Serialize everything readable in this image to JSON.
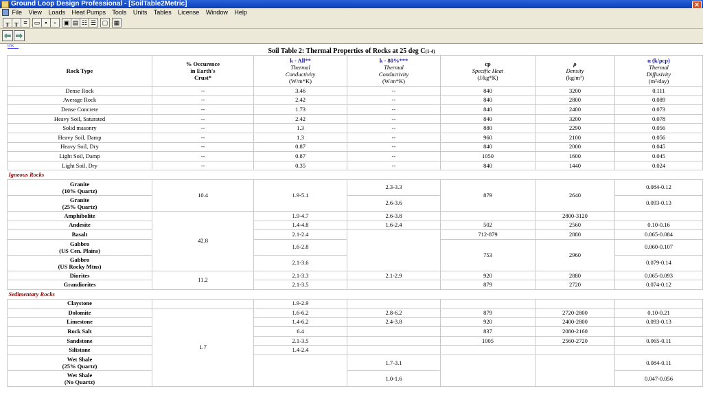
{
  "window": {
    "title": "Ground Loop Design Professional - [SoilTable2Metric]"
  },
  "menu": [
    "File",
    "View",
    "Loads",
    "Heat Pumps",
    "Tools",
    "Units",
    "Tables",
    "License",
    "Window",
    "Help"
  ],
  "nav": {
    "back_label": "⇦",
    "forward_label": "⇨"
  },
  "table": {
    "caption": "Soil Table 2: Thermal Properties of Rocks at 25 deg C",
    "caption_ref": "(1-4)",
    "headers": {
      "rock_type": "Rock Type",
      "occ_1": "% Occurence",
      "occ_2": "in Earth's",
      "occ_3": "Crust*",
      "kall_1": "k - All**",
      "kall_2": "Thermal",
      "kall_3": "Conductivity",
      "kall_4": "(W/m*K)",
      "k80_1": "k - 80%***",
      "k80_2": "Thermal",
      "k80_3": "Conductivity",
      "k80_4": "(W/m*K)",
      "cp_1": "cp",
      "cp_2": "Specific Heat",
      "cp_3": "(J/kg*K)",
      "rho_1": "ρ",
      "rho_2": "Density",
      "rho_3": "(kg/m³)",
      "alpha_1": "α (k/ρcp)",
      "alpha_2": "Thermal",
      "alpha_3": "Diffusivity",
      "alpha_4": "(m²/day)"
    },
    "general_rows": [
      [
        "Dense Rock",
        "--",
        "3.46",
        "--",
        "840",
        "3200",
        "0.111"
      ],
      [
        "Average Rock",
        "--",
        "2.42",
        "--",
        "840",
        "2800",
        "0.089"
      ],
      [
        "Dense Concrete",
        "--",
        "1.73",
        "--",
        "840",
        "2400",
        "0.073"
      ],
      [
        "Heavy Soil, Saturated",
        "--",
        "2.42",
        "--",
        "840",
        "3200",
        "0.078"
      ],
      [
        "Solid masonry",
        "--",
        "1.3",
        "--",
        "880",
        "2290",
        "0.056"
      ],
      [
        "Heavy Soil, Damp",
        "--",
        "1.3",
        "--",
        "960",
        "2100",
        "0.056"
      ],
      [
        "Heavy Soil, Dry",
        "--",
        "0.87",
        "--",
        "840",
        "2000",
        "0.045"
      ],
      [
        "Light Soil, Damp",
        "--",
        "0.87",
        "--",
        "1050",
        "1600",
        "0.045"
      ],
      [
        "Light Soil, Dry",
        "--",
        "0.35",
        "--",
        "840",
        "1440",
        "0.024"
      ]
    ],
    "igneous": {
      "section": "Igneous Rocks",
      "granite10_a": "Granite",
      "granite10_b": "(10% Quartz)",
      "granite25_a": "Granite",
      "granite25_b": "(25% Quartz)",
      "granite_occ": "10.4",
      "granite_kall": "1.9-5.1",
      "granite10_k80": "2.3-3.3",
      "granite25_k80": "2.6-3.6",
      "granite_cp": "879",
      "granite_rho": "2640",
      "granite10_alpha": "0.084-0.12",
      "granite25_alpha": "0.093-0.13",
      "amph": "Amphibolite",
      "amph_kall": "1.9-4.7",
      "amph_k80": "2.6-3.8",
      "amph_rho": "2800-3120",
      "mafic_occ": "42.8",
      "and": "Andesite",
      "and_kall": "1.4-4.8",
      "and_k80": "1.6-2.4",
      "and_cp": "502",
      "and_rho": "2560",
      "and_alpha": "0.10-0.16",
      "bas": "Basalt",
      "bas_kall": "2.1-2.4",
      "bas_cp": "712-879",
      "bas_rho": "2880",
      "bas_alpha": "0.065-0.084",
      "gab1_a": "Gabbro",
      "gab1_b": "(US Cen. Plains)",
      "gab1_kall": "1.6-2.8",
      "gab1_alpha": "0.060-0.107",
      "gab2_a": "Gabbro",
      "gab2_b": "(US Rocky Mtns)",
      "gab2_kall": "2.1-3.6",
      "gab2_alpha": "0.079-0.14",
      "gab_cp": "753",
      "gab_rho": "2960",
      "dio": "Diorites",
      "dio_kall": "2.1-3.3",
      "dio_k80": "2.1-2.9",
      "dio_cp": "920",
      "dio_rho": "2880",
      "dio_alpha": "0.065-0.093",
      "gran": "Grandiorites",
      "gran_kall": "2.1-3.5",
      "gran_cp": "879",
      "gran_rho": "2720",
      "gran_alpha": "0.074-0.12",
      "dio_occ": "11.2"
    },
    "sedimentary": {
      "section": "Sedimentary Rocks",
      "clay": "Claystone",
      "clay_kall": "1.9-2.9",
      "dol": "Dolomite",
      "dol_kall": "1.6-6.2",
      "dol_k80": "2.8-6.2",
      "dol_cp": "879",
      "dol_rho": "2720-2800",
      "dol_alpha": "0.10-0.21",
      "lime": "Limestone",
      "lime_kall": "1.4-6.2",
      "lime_k80": "2.4-3.8",
      "lime_cp": "920",
      "lime_rho": "2400-2800",
      "lime_alpha": "0.093-0.13",
      "salt": "Rock Salt",
      "salt_kall": "6.4",
      "salt_cp": "837",
      "salt_rho": "2080-2160",
      "sand": "Sandstone",
      "sand_occ": "1.7",
      "sand_kall": "2.1-3.5",
      "sand_cp": "1005",
      "sand_rho": "2560-2720",
      "sand_alpha": "0.065-0.11",
      "silt": "Siltstone",
      "silt_kall": "1.4-2.4",
      "ws1_a": "Wet Shale",
      "ws1_b": "(25% Quartz)",
      "ws1_k80": "1.7-3.1",
      "ws1_alpha": "0.084-0.11",
      "ws2_a": "Wet Shale",
      "ws2_b": "(No Quartz)",
      "ws2_k80": "1.0-1.6",
      "ws2_alpha": "0.047-0.056"
    }
  }
}
